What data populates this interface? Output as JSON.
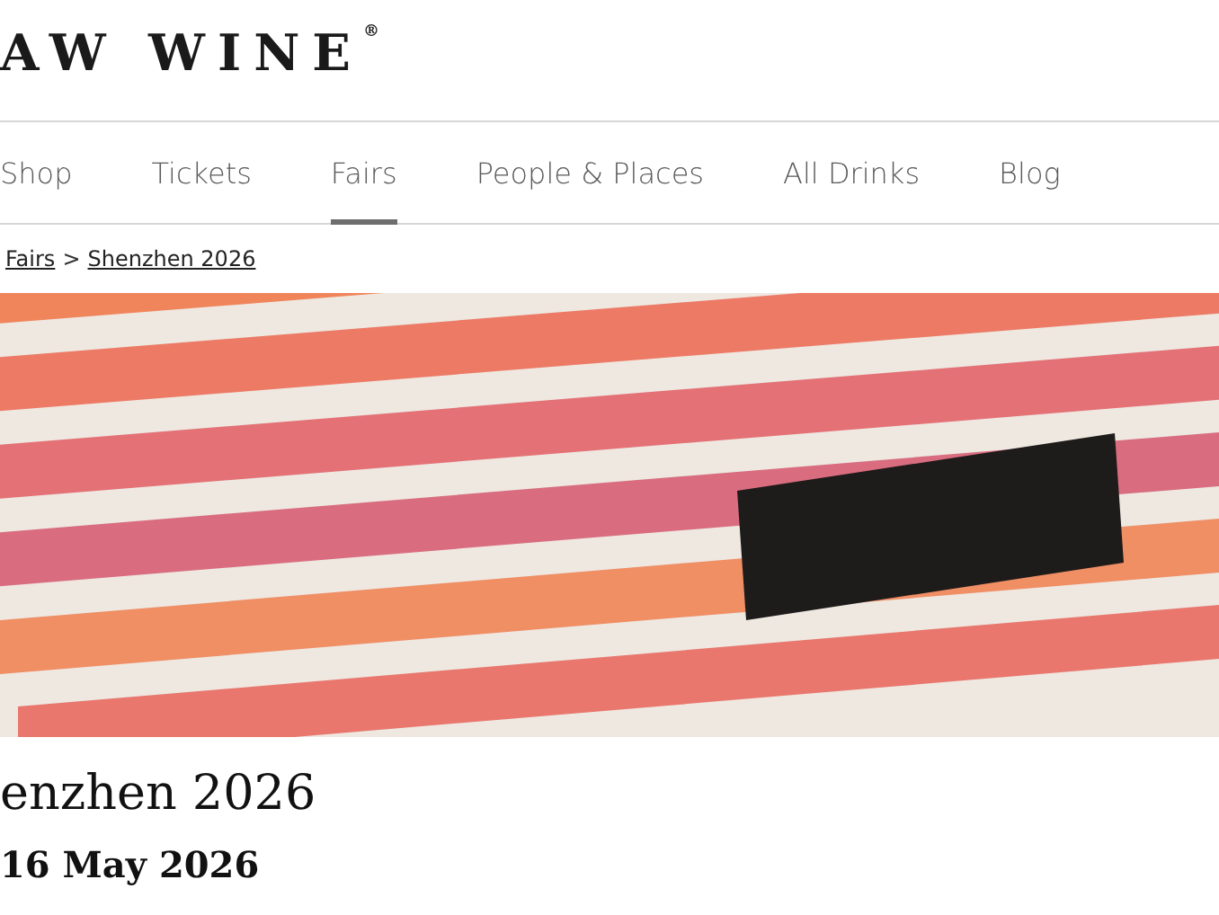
{
  "logo": {
    "text": "AW WINE",
    "mark": "®"
  },
  "nav": [
    {
      "label": "Shop",
      "selected": false
    },
    {
      "label": "Tickets",
      "selected": false
    },
    {
      "label": "Fairs",
      "selected": true
    },
    {
      "label": "People & Places",
      "selected": false
    },
    {
      "label": "All Drinks",
      "selected": false
    },
    {
      "label": "Blog",
      "selected": false
    }
  ],
  "breadcrumb": {
    "links": [
      "Fairs",
      "Shenzhen 2026"
    ],
    "separator": ">"
  },
  "title": "enzhen 2026",
  "date": "16 May 2026"
}
